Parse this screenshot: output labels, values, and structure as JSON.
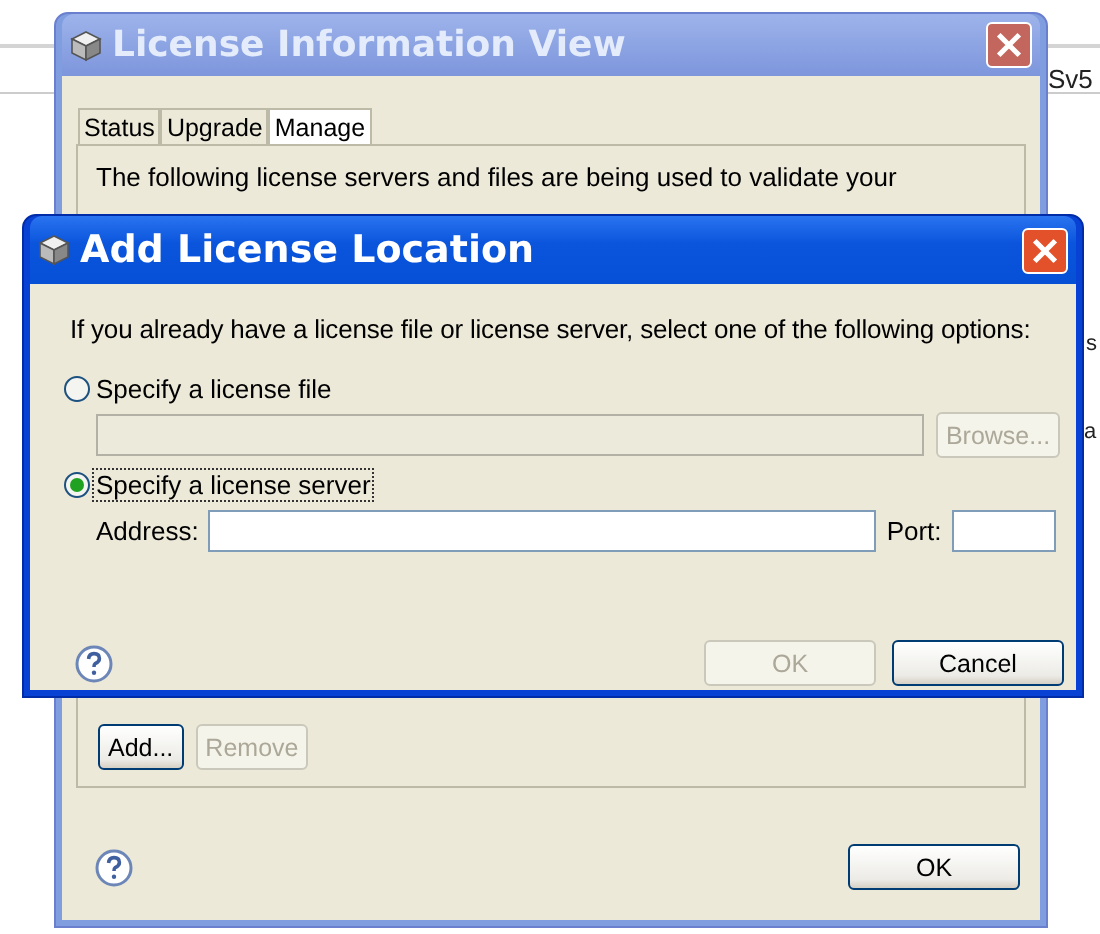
{
  "background": {
    "texts": [
      "Sv5",
      "s",
      "a"
    ]
  },
  "license_window": {
    "title": "License Information View",
    "tabs": [
      {
        "label": "Status",
        "selected": false
      },
      {
        "label": "Upgrade",
        "selected": false
      },
      {
        "label": "Manage",
        "selected": true
      }
    ],
    "description": "The following license servers and files are being used to validate your",
    "buttons": [
      {
        "label": "Add...",
        "disabled": false
      },
      {
        "label": "Remove",
        "disabled": true
      }
    ],
    "ok_button": "OK"
  },
  "dialog": {
    "title": "Add License Location",
    "instruction": "If you already have a license file or license server, select one of the following options:",
    "options": [
      {
        "label": "Specify a license file",
        "selected": false
      },
      {
        "label": "Specify a license server",
        "selected": true
      }
    ],
    "file_field": {
      "disabled": true
    },
    "browse_button": {
      "label": "Browse...",
      "disabled": true
    },
    "address_label": "Address:",
    "port_label": "Port:",
    "buttons": [
      {
        "label": "OK",
        "disabled": true
      },
      {
        "label": "Cancel",
        "disabled": false
      }
    ]
  }
}
